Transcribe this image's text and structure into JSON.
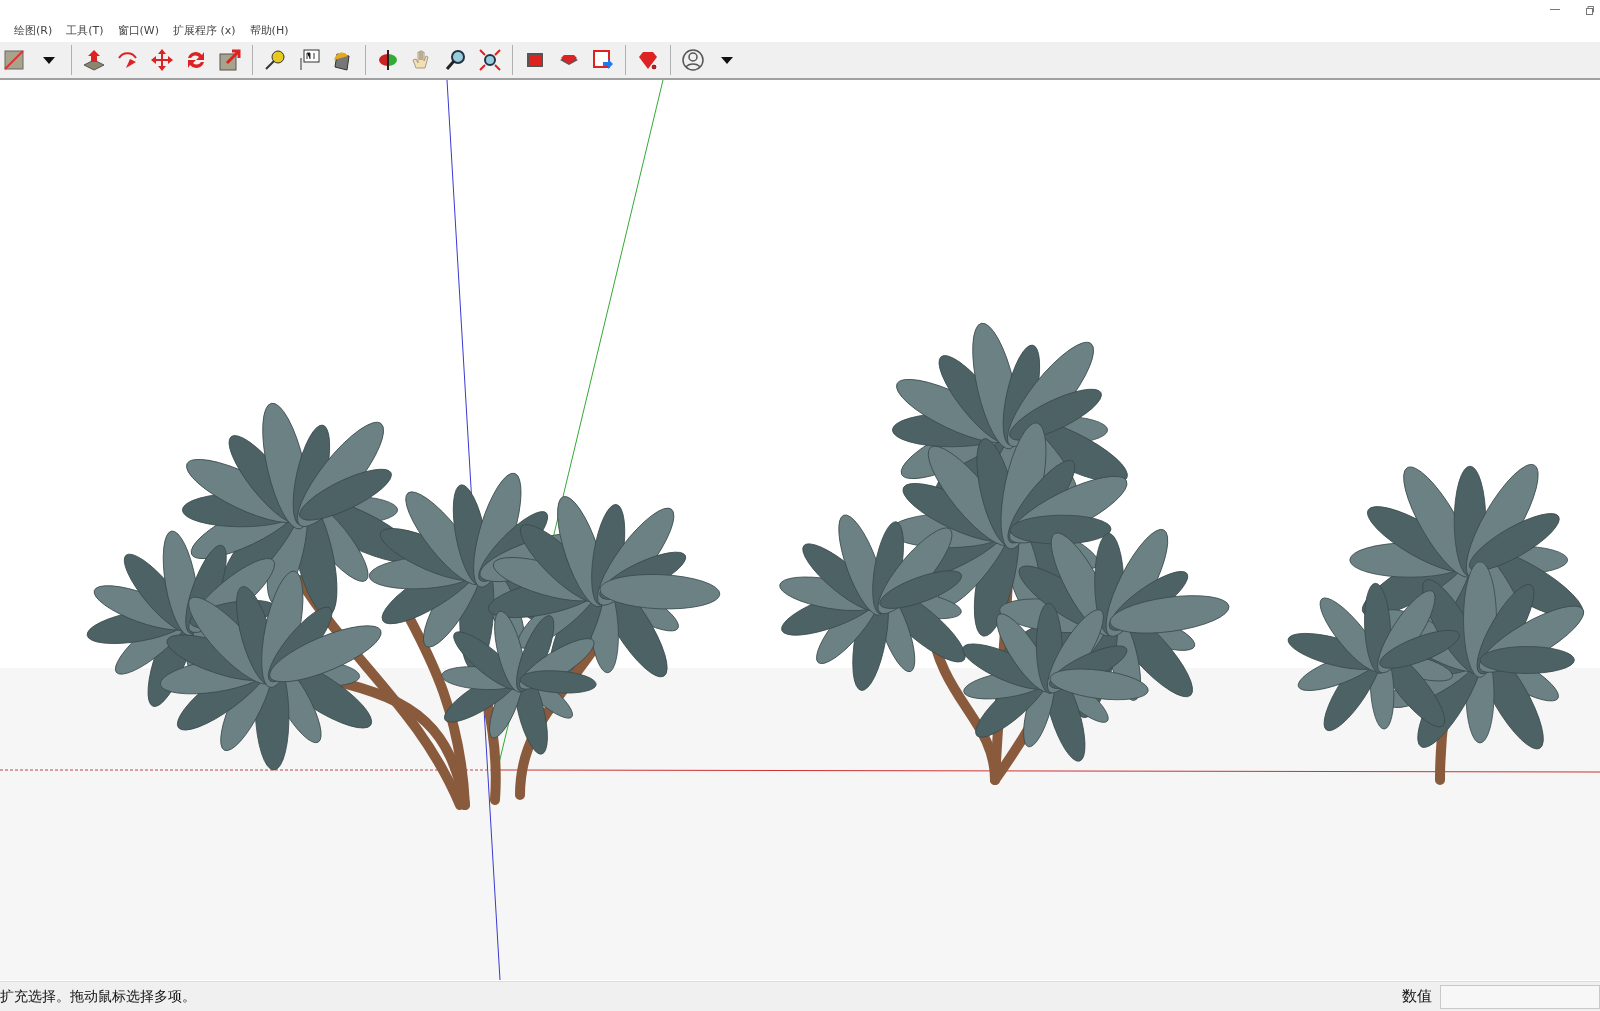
{
  "menu_bar": {
    "items": [
      {
        "label": "绘图(R)"
      },
      {
        "label": "工具(T)"
      },
      {
        "label": "窗口(W)"
      },
      {
        "label": "扩展程序 (x)"
      },
      {
        "label": "帮助(H)"
      }
    ]
  },
  "status_bar": {
    "hint": "扩充选择。拖动鼠标选择多项。",
    "measurement_label": "数值"
  }
}
